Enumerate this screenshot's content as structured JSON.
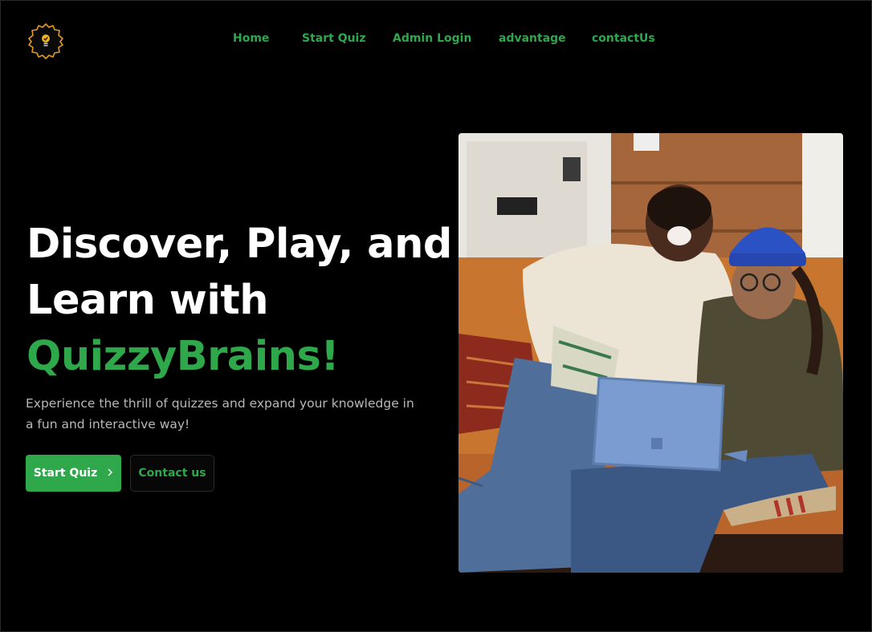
{
  "nav": {
    "items": [
      {
        "label": "Home"
      },
      {
        "label": "Start Quiz"
      },
      {
        "label": "Admin Login"
      },
      {
        "label": "advantage"
      },
      {
        "label": "contactUs"
      }
    ]
  },
  "hero": {
    "title_line1": "Discover, Play, and",
    "title_line2": "Learn with",
    "title_brand": "QuizzyBrains!",
    "subtitle": "Experience the thrill of quizzes and expand your knowledge in a fun and interactive way!",
    "primary_button": "Start Quiz",
    "secondary_button": "Contact us"
  },
  "icons": {
    "logo": "lightbulb-badge-icon",
    "button_arrow": "chevron-right-icon"
  },
  "colors": {
    "accent": "#2ea84a",
    "background": "#000000",
    "logo_accent": "#e39b1d"
  }
}
